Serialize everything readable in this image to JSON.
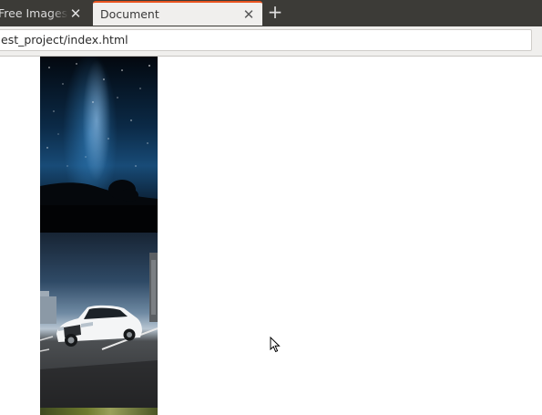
{
  "tabs": [
    {
      "title": "Free Images &",
      "active": false
    },
    {
      "title": "Document",
      "active": true
    }
  ],
  "tab_close_glyph": "✕",
  "new_tab_glyph": "+",
  "address_bar": {
    "url": "file:///home/test_project/index.html",
    "visible_text": "est_project/index.html"
  },
  "page": {
    "images": [
      {
        "subject": "milky-way-night-sky"
      },
      {
        "subject": "white-sedan-car-parking-lot"
      },
      {
        "subject": "next-image-partially-visible"
      }
    ]
  },
  "icons": {
    "tab_close": "close-icon",
    "new_tab": "plus-icon",
    "cursor": "mouse-pointer-icon"
  },
  "colors": {
    "tabbar_bg": "#3c3b37",
    "active_tab_bg": "#f0efed",
    "active_tab_accent": "#e95420",
    "page_bg": "#ffffff"
  }
}
